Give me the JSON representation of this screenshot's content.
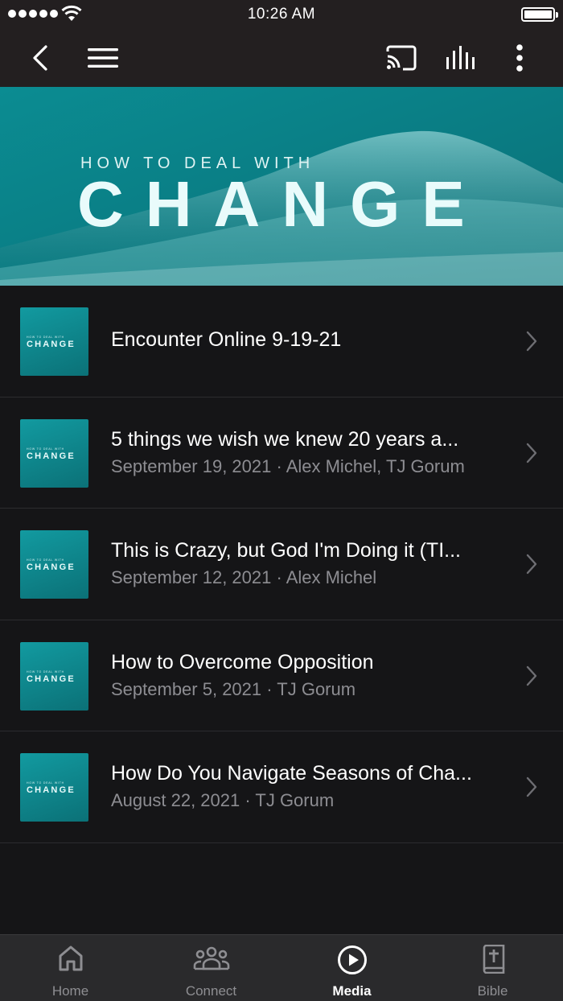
{
  "status_bar": {
    "time": "10:26 AM"
  },
  "banner": {
    "subtitle": "HOW TO DEAL WITH",
    "title": "CHANGE"
  },
  "thumbnail": {
    "subtitle": "HOW TO DEAL WITH",
    "title": "CHANGE"
  },
  "episodes": [
    {
      "title": "Encounter Online 9-19-21",
      "meta": ""
    },
    {
      "title": "5 things we wish we knew 20 years a...",
      "meta": "September 19, 2021 · Alex Michel, TJ Gorum"
    },
    {
      "title": "This is Crazy, but God I'm Doing it (TI...",
      "meta": "September 12, 2021 · Alex Michel"
    },
    {
      "title": "How to Overcome Opposition",
      "meta": "September 5, 2021 · TJ Gorum"
    },
    {
      "title": "How Do You Navigate Seasons of Cha...",
      "meta": "August 22, 2021 · TJ Gorum"
    }
  ],
  "tabs": [
    {
      "label": "Home",
      "icon": "home-icon",
      "active": false
    },
    {
      "label": "Connect",
      "icon": "people-icon",
      "active": false
    },
    {
      "label": "Media",
      "icon": "play-circle-icon",
      "active": true
    },
    {
      "label": "Bible",
      "icon": "bible-icon",
      "active": false
    }
  ],
  "colors": {
    "background": "#151517",
    "header": "#231f20",
    "accent": "#0b8c92",
    "muted_text": "#8d8d92"
  }
}
